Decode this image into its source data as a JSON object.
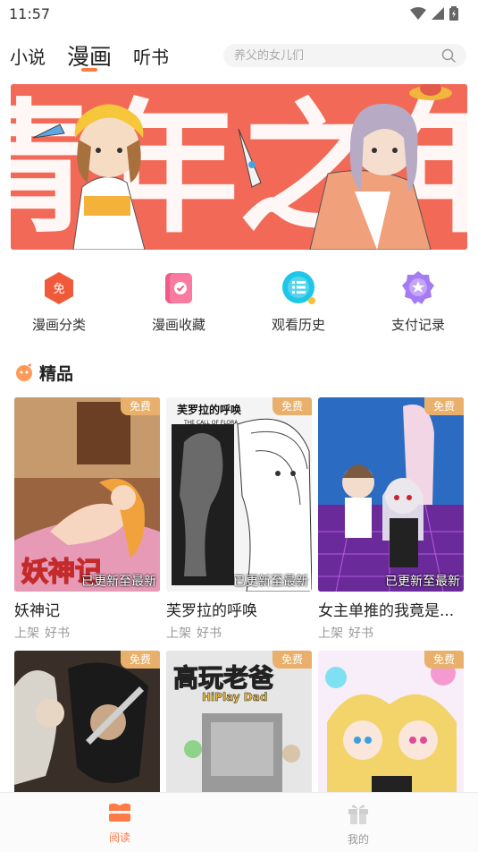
{
  "status_bar": {
    "time": "11:57"
  },
  "top_nav": {
    "tabs": [
      {
        "label": "小说"
      },
      {
        "label": "漫画"
      },
      {
        "label": "听书"
      }
    ],
    "active_tab": "漫画",
    "search_placeholder": "养父的女儿们",
    "accent_color": "#ff7a45"
  },
  "banner": {
    "title_art": "青年之年"
  },
  "quick_actions": [
    {
      "label": "漫画分类",
      "icon": "category-badge-icon",
      "badge_text": "免",
      "color": "#f05a3a"
    },
    {
      "label": "漫画收藏",
      "icon": "bookmark-check-icon",
      "color": "#f25a8a"
    },
    {
      "label": "观看历史",
      "icon": "history-list-icon",
      "color": "#1ec6e8"
    },
    {
      "label": "支付记录",
      "icon": "payment-star-icon",
      "color": "#a57bf2"
    }
  ],
  "section": {
    "title": "精品",
    "icon": "boutique-icon"
  },
  "comics": [
    {
      "title": "妖神记",
      "badge": "免费",
      "update_note": "已更新至最新",
      "tags": [
        "上架",
        "好书"
      ],
      "cover_text": "妖神记"
    },
    {
      "title": "芙罗拉的呼唤",
      "badge": "免费",
      "update_note": "已更新至最新",
      "tags": [
        "上架",
        "好书"
      ],
      "cover_text": "芙罗拉的呼唤",
      "cover_subtext": "THE CALL OF FLORA"
    },
    {
      "title": "女主单推的我竟是...",
      "badge": "免费",
      "update_note": "已更新至最新",
      "tags": [
        "上架",
        "好书"
      ]
    },
    {
      "title": "",
      "badge": "免费"
    },
    {
      "title": "",
      "badge": "免费",
      "cover_text": "高玩老爸",
      "cover_subtext": "HiPlay Dad"
    },
    {
      "title": "",
      "badge": "免费"
    }
  ],
  "bottom_nav": {
    "tabs": [
      {
        "label": "阅读",
        "icon": "read-icon",
        "active": true
      },
      {
        "label": "我的",
        "icon": "gift-icon",
        "active": false
      }
    ],
    "active_color": "#ff7a45",
    "inactive_color": "#999999"
  }
}
